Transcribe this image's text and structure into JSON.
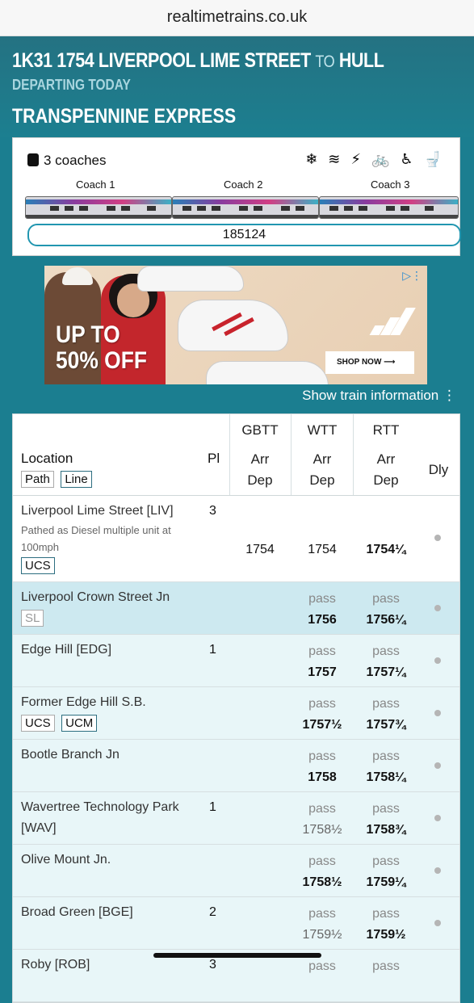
{
  "browser": {
    "url": "realtimetrains.co.uk"
  },
  "header": {
    "service_id": "1K31 1754 Liverpool Lime Street",
    "to_word": "to",
    "destination": "Hull",
    "departing": "Departing today",
    "operator": "TransPennine Express"
  },
  "train": {
    "coaches_text": "3 coaches",
    "amenities": "❄ ≋ ⚡ 🚲 ♿ 🚽",
    "coach_labels": [
      "Coach 1",
      "Coach 2",
      "Coach 3"
    ],
    "unit_number": "185124"
  },
  "ad": {
    "promo_line1": "UP TO",
    "promo_line2": "50% OFF",
    "cta": "SHOP NOW",
    "cta_arrow": "⟶"
  },
  "show_info": "Show train information ⋮",
  "table": {
    "headers": {
      "location": "Location",
      "pl": "Pl",
      "gbtt": "GBTT",
      "wtt": "WTT",
      "rtt": "RTT",
      "arr": "Arr",
      "dep": "Dep",
      "dly": "Dly"
    },
    "filter_tags": [
      "Path",
      "Line"
    ],
    "rows": [
      {
        "location": "Liverpool Lime Street [LIV]",
        "platform": "3",
        "note": "Pathed as Diesel multiple unit at 100mph",
        "tags": [
          "UCS"
        ],
        "gbtt": "1754",
        "wtt": "1754",
        "rtt": "1754¼"
      },
      {
        "location": "Liverpool Crown Street Jn",
        "platform": "",
        "tags": [
          "SL"
        ],
        "wtt_top": "pass",
        "wtt": "1756",
        "rtt_top": "pass",
        "rtt": "1756¼"
      },
      {
        "location": "Edge Hill [EDG]",
        "platform": "1",
        "wtt_top": "pass",
        "wtt": "1757",
        "rtt_top": "pass",
        "rtt": "1757¼"
      },
      {
        "location": "Former Edge Hill S.B.",
        "platform": "",
        "tags": [
          "UCS",
          "UCM"
        ],
        "wtt_top": "pass",
        "wtt": "1757½",
        "rtt_top": "pass",
        "rtt": "1757¾"
      },
      {
        "location": "Bootle Branch Jn",
        "platform": "",
        "wtt_top": "pass",
        "wtt": "1758",
        "rtt_top": "pass",
        "rtt": "1758¼"
      },
      {
        "location": "Wavertree Technology Park",
        "location2": "[WAV]",
        "platform": "1",
        "wtt_top": "pass",
        "wtt": "1758½",
        "rtt_top": "pass",
        "rtt": "1758¾"
      },
      {
        "location": "Olive Mount Jn.",
        "platform": "",
        "wtt_top": "pass",
        "wtt": "1758½",
        "rtt_top": "pass",
        "rtt": "1759¼"
      },
      {
        "location": "Broad Green [BGE]",
        "platform": "2",
        "wtt_top": "pass",
        "wtt": "1759½",
        "rtt_top": "pass",
        "rtt": "1759½"
      },
      {
        "location": "Roby [ROB]",
        "platform": "3",
        "wtt_top": "pass",
        "rtt_top": "pass"
      }
    ]
  }
}
